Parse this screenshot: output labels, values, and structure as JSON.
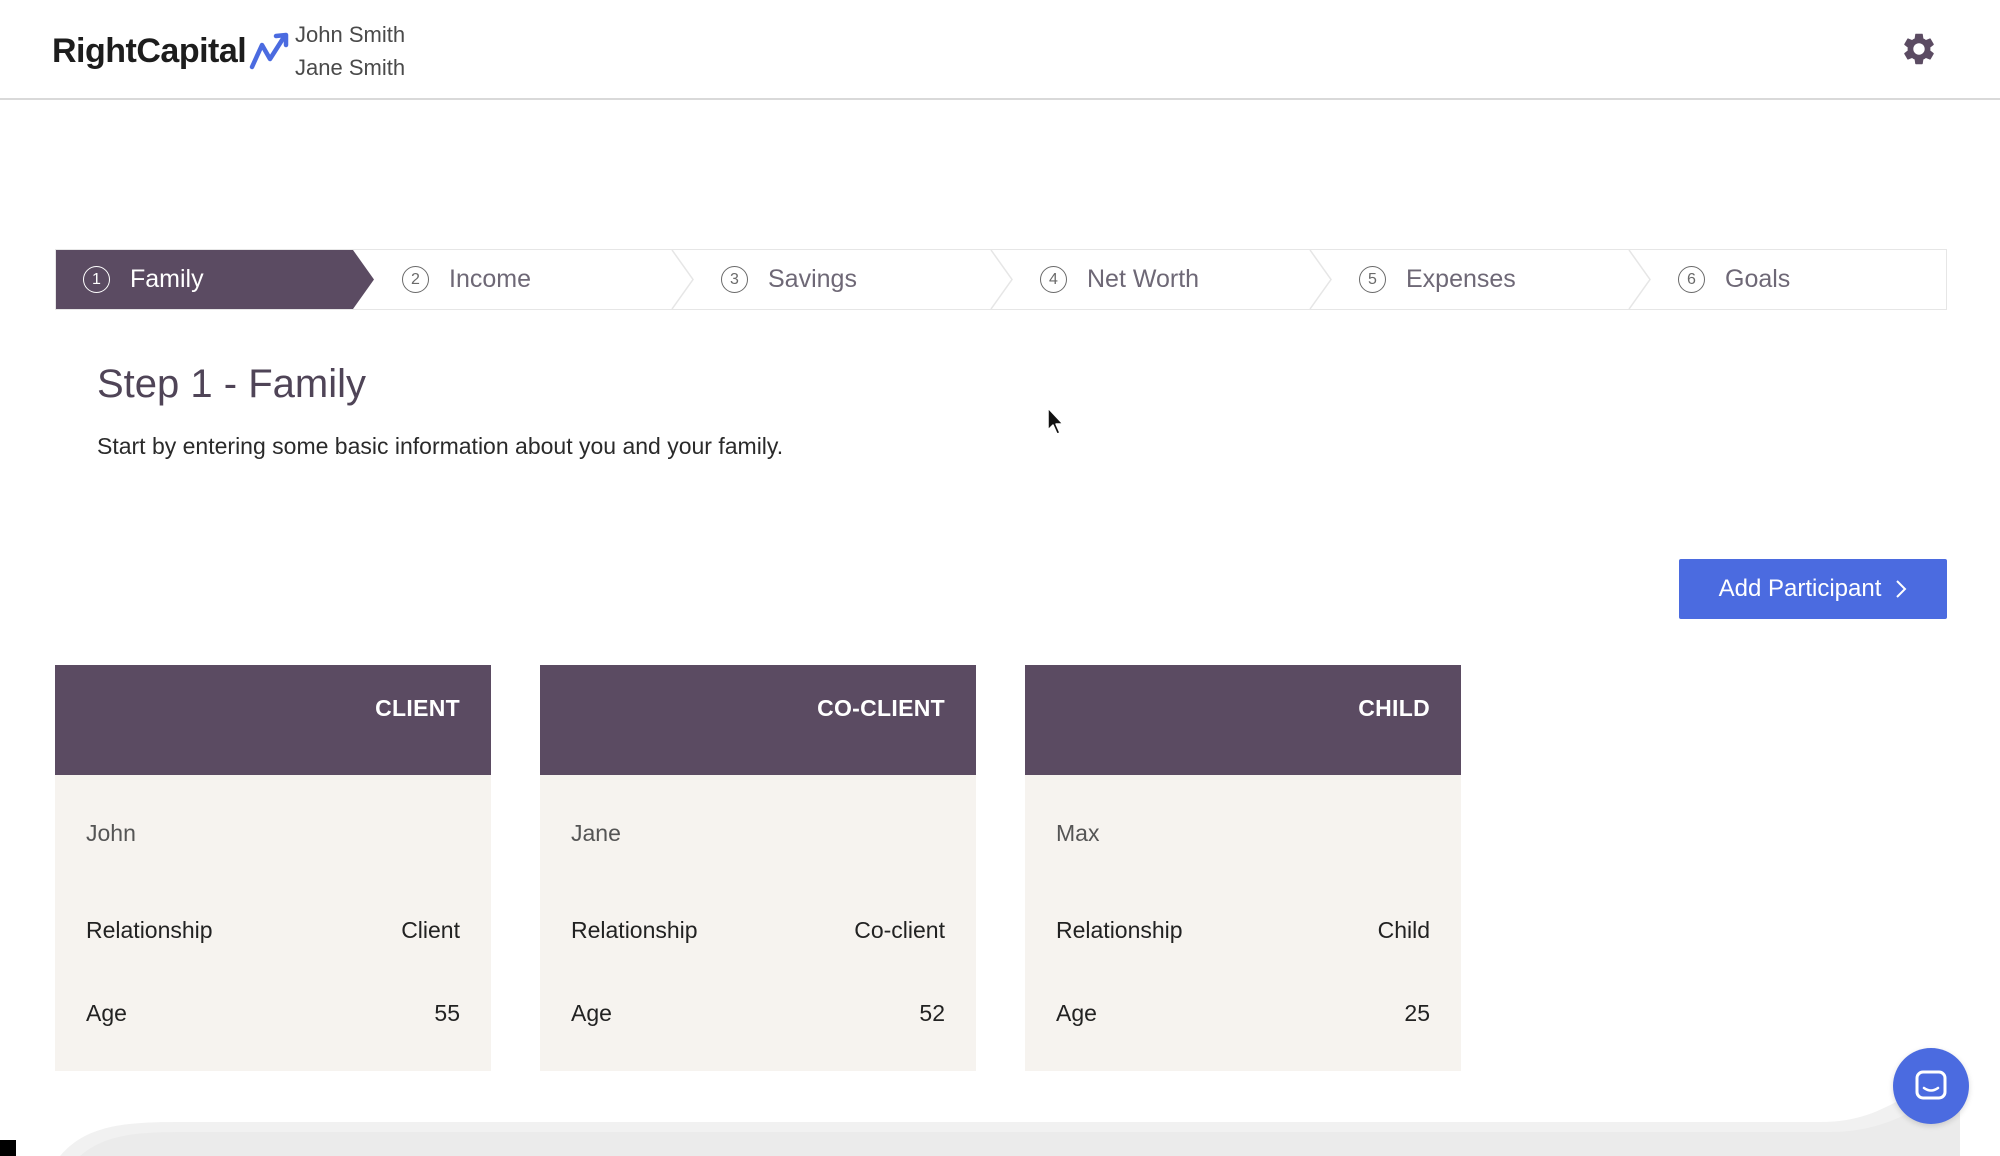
{
  "header": {
    "logo_text": "RightCapital",
    "clients": [
      "John Smith",
      "Jane Smith"
    ],
    "settings_icon": "gear-icon"
  },
  "stepper": {
    "active_index": 0,
    "steps": [
      {
        "num": "1",
        "label": "Family"
      },
      {
        "num": "2",
        "label": "Income"
      },
      {
        "num": "3",
        "label": "Savings"
      },
      {
        "num": "4",
        "label": "Net Worth"
      },
      {
        "num": "5",
        "label": "Expenses"
      },
      {
        "num": "6",
        "label": "Goals"
      }
    ]
  },
  "page": {
    "title": "Step 1 - Family",
    "description": "Start by entering some basic information about you and your family."
  },
  "actions": {
    "add_participant": "Add Participant",
    "add_participant_icon": "chevron-right-icon"
  },
  "participants": [
    {
      "role": "CLIENT",
      "name": "John",
      "relationship_label": "Relationship",
      "relationship": "Client",
      "age_label": "Age",
      "age": "55"
    },
    {
      "role": "CO-CLIENT",
      "name": "Jane",
      "relationship_label": "Relationship",
      "relationship": "Co-client",
      "age_label": "Age",
      "age": "52"
    },
    {
      "role": "CHILD",
      "name": "Max",
      "relationship_label": "Relationship",
      "relationship": "Child",
      "age_label": "Age",
      "age": "25"
    }
  ],
  "chat": {
    "icon": "chat-icon"
  },
  "colors": {
    "brand_purple": "#5b4b62",
    "accent_blue": "#4b6be0",
    "card_bg": "#f6f3ef"
  }
}
